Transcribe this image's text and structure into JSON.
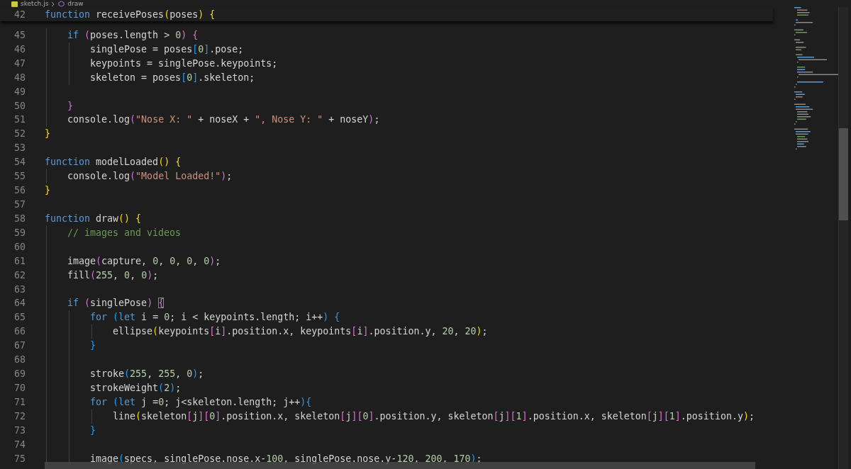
{
  "breadcrumb": {
    "file": "sketch.js",
    "symbol": "draw"
  },
  "sticky_line": {
    "number": "42",
    "tokens": [
      {
        "kind": "kw",
        "text": "function"
      },
      {
        "kind": "text",
        "text": " receivePoses"
      },
      {
        "kind": "b1",
        "text": "("
      },
      {
        "kind": "text",
        "text": "poses"
      },
      {
        "kind": "b1",
        "text": ")"
      },
      {
        "kind": "b1",
        "text": " {"
      }
    ]
  },
  "lines": [
    {
      "number": "45",
      "tokens": [
        {
          "kind": "kw",
          "text": "    if"
        },
        {
          "kind": "b2",
          "text": " ("
        },
        {
          "kind": "text",
          "text": "poses.length > "
        },
        {
          "kind": "num",
          "text": "0"
        },
        {
          "kind": "b2",
          "text": ")"
        },
        {
          "kind": "b2",
          "text": " {"
        }
      ]
    },
    {
      "number": "46",
      "tokens": [
        {
          "kind": "text",
          "text": "        singlePose = poses"
        },
        {
          "kind": "b3",
          "text": "["
        },
        {
          "kind": "num",
          "text": "0"
        },
        {
          "kind": "b3",
          "text": "]"
        },
        {
          "kind": "text",
          "text": ".pose;"
        }
      ]
    },
    {
      "number": "47",
      "tokens": [
        {
          "kind": "text",
          "text": "        keypoints = singlePose.keypoints;"
        }
      ]
    },
    {
      "number": "48",
      "tokens": [
        {
          "kind": "text",
          "text": "        skeleton = poses"
        },
        {
          "kind": "b3",
          "text": "["
        },
        {
          "kind": "num",
          "text": "0"
        },
        {
          "kind": "b3",
          "text": "]"
        },
        {
          "kind": "text",
          "text": ".skeleton;"
        }
      ]
    },
    {
      "number": "49"
    },
    {
      "number": "50",
      "tokens": [
        {
          "kind": "b2",
          "text": "    }"
        }
      ]
    },
    {
      "number": "51",
      "tokens": [
        {
          "kind": "text",
          "text": "    console.log"
        },
        {
          "kind": "b2",
          "text": "("
        },
        {
          "kind": "str",
          "text": "\"Nose X: \""
        },
        {
          "kind": "text",
          "text": " + noseX + "
        },
        {
          "kind": "str",
          "text": "\", Nose Y: \""
        },
        {
          "kind": "text",
          "text": " + noseY"
        },
        {
          "kind": "b2",
          "text": ")"
        },
        {
          "kind": "text",
          "text": ";"
        }
      ]
    },
    {
      "number": "52",
      "tokens": [
        {
          "kind": "b1",
          "text": "}"
        }
      ]
    },
    {
      "number": "53"
    },
    {
      "number": "54",
      "tokens": [
        {
          "kind": "kw",
          "text": "function"
        },
        {
          "kind": "text",
          "text": " modelLoaded"
        },
        {
          "kind": "b1",
          "text": "() {"
        }
      ]
    },
    {
      "number": "55",
      "tokens": [
        {
          "kind": "text",
          "text": "    console.log"
        },
        {
          "kind": "b2",
          "text": "("
        },
        {
          "kind": "str",
          "text": "\"Model Loaded!\""
        },
        {
          "kind": "b2",
          "text": ")"
        },
        {
          "kind": "text",
          "text": ";"
        }
      ]
    },
    {
      "number": "56",
      "tokens": [
        {
          "kind": "b1",
          "text": "}"
        }
      ]
    },
    {
      "number": "57"
    },
    {
      "number": "58",
      "tokens": [
        {
          "kind": "kw",
          "text": "function"
        },
        {
          "kind": "text",
          "text": " draw"
        },
        {
          "kind": "b1",
          "text": "() {"
        }
      ]
    },
    {
      "number": "59",
      "tokens": [
        {
          "kind": "cmt",
          "text": "    // images and videos"
        }
      ]
    },
    {
      "number": "60"
    },
    {
      "number": "61",
      "tokens": [
        {
          "kind": "text",
          "text": "    image"
        },
        {
          "kind": "b2",
          "text": "("
        },
        {
          "kind": "text",
          "text": "capture, "
        },
        {
          "kind": "num",
          "text": "0"
        },
        {
          "kind": "text",
          "text": ", "
        },
        {
          "kind": "num",
          "text": "0"
        },
        {
          "kind": "text",
          "text": ", "
        },
        {
          "kind": "num",
          "text": "0"
        },
        {
          "kind": "text",
          "text": ", "
        },
        {
          "kind": "num",
          "text": "0"
        },
        {
          "kind": "b2",
          "text": ")"
        },
        {
          "kind": "text",
          "text": ";"
        }
      ]
    },
    {
      "number": "62",
      "tokens": [
        {
          "kind": "text",
          "text": "    fill"
        },
        {
          "kind": "b2",
          "text": "("
        },
        {
          "kind": "num",
          "text": "255"
        },
        {
          "kind": "text",
          "text": ", "
        },
        {
          "kind": "num",
          "text": "0"
        },
        {
          "kind": "text",
          "text": ", "
        },
        {
          "kind": "num",
          "text": "0"
        },
        {
          "kind": "b2",
          "text": ")"
        },
        {
          "kind": "text",
          "text": ";"
        }
      ]
    },
    {
      "number": "63"
    },
    {
      "number": "64",
      "tokens": [
        {
          "kind": "kw",
          "text": "    if"
        },
        {
          "kind": "b2",
          "text": " ("
        },
        {
          "kind": "text",
          "text": "singlePose"
        },
        {
          "kind": "b2",
          "text": ") "
        },
        {
          "kind": "b2-match",
          "text": "{"
        }
      ]
    },
    {
      "number": "65",
      "tokens": [
        {
          "kind": "kw",
          "text": "        for"
        },
        {
          "kind": "b3",
          "text": " ("
        },
        {
          "kind": "kw",
          "text": "let"
        },
        {
          "kind": "text",
          "text": " i = "
        },
        {
          "kind": "num",
          "text": "0"
        },
        {
          "kind": "text",
          "text": "; i < keypoints.length; i++"
        },
        {
          "kind": "b3",
          "text": ") {"
        }
      ]
    },
    {
      "number": "66",
      "tokens": [
        {
          "kind": "text",
          "text": "            ellipse"
        },
        {
          "kind": "b1",
          "text": "("
        },
        {
          "kind": "text",
          "text": "keypoints"
        },
        {
          "kind": "b2",
          "text": "["
        },
        {
          "kind": "text",
          "text": "i"
        },
        {
          "kind": "b2",
          "text": "]"
        },
        {
          "kind": "text",
          "text": ".position.x, keypoints"
        },
        {
          "kind": "b2",
          "text": "["
        },
        {
          "kind": "text",
          "text": "i"
        },
        {
          "kind": "b2",
          "text": "]"
        },
        {
          "kind": "text",
          "text": ".position.y, "
        },
        {
          "kind": "num",
          "text": "20"
        },
        {
          "kind": "text",
          "text": ", "
        },
        {
          "kind": "num",
          "text": "20"
        },
        {
          "kind": "b1",
          "text": ")"
        },
        {
          "kind": "text",
          "text": ";"
        }
      ]
    },
    {
      "number": "67",
      "tokens": [
        {
          "kind": "b3",
          "text": "        }"
        }
      ]
    },
    {
      "number": "68"
    },
    {
      "number": "69",
      "tokens": [
        {
          "kind": "text",
          "text": "        stroke"
        },
        {
          "kind": "b3",
          "text": "("
        },
        {
          "kind": "num",
          "text": "255"
        },
        {
          "kind": "text",
          "text": ", "
        },
        {
          "kind": "num",
          "text": "255"
        },
        {
          "kind": "text",
          "text": ", "
        },
        {
          "kind": "num",
          "text": "0"
        },
        {
          "kind": "b3",
          "text": ")"
        },
        {
          "kind": "text",
          "text": ";"
        }
      ]
    },
    {
      "number": "70",
      "tokens": [
        {
          "kind": "text",
          "text": "        strokeWeight"
        },
        {
          "kind": "b3",
          "text": "("
        },
        {
          "kind": "num",
          "text": "2"
        },
        {
          "kind": "b3",
          "text": ")"
        },
        {
          "kind": "text",
          "text": ";"
        }
      ]
    },
    {
      "number": "71",
      "tokens": [
        {
          "kind": "kw",
          "text": "        for"
        },
        {
          "kind": "b3",
          "text": " ("
        },
        {
          "kind": "kw",
          "text": "let"
        },
        {
          "kind": "text",
          "text": " j ="
        },
        {
          "kind": "num",
          "text": "0"
        },
        {
          "kind": "text",
          "text": "; j<skeleton.length; j++"
        },
        {
          "kind": "b3",
          "text": "){"
        }
      ]
    },
    {
      "number": "72",
      "tokens": [
        {
          "kind": "text",
          "text": "            line"
        },
        {
          "kind": "b1",
          "text": "("
        },
        {
          "kind": "text",
          "text": "skeleton"
        },
        {
          "kind": "b2",
          "text": "["
        },
        {
          "kind": "text",
          "text": "j"
        },
        {
          "kind": "b2",
          "text": "]["
        },
        {
          "kind": "num",
          "text": "0"
        },
        {
          "kind": "b2",
          "text": "]"
        },
        {
          "kind": "text",
          "text": ".position.x, skeleton"
        },
        {
          "kind": "b2",
          "text": "["
        },
        {
          "kind": "text",
          "text": "j"
        },
        {
          "kind": "b2",
          "text": "]["
        },
        {
          "kind": "num",
          "text": "0"
        },
        {
          "kind": "b2",
          "text": "]"
        },
        {
          "kind": "text",
          "text": ".position.y, skeleton"
        },
        {
          "kind": "b2",
          "text": "["
        },
        {
          "kind": "text",
          "text": "j"
        },
        {
          "kind": "b2",
          "text": "]["
        },
        {
          "kind": "num",
          "text": "1"
        },
        {
          "kind": "b2",
          "text": "]"
        },
        {
          "kind": "text",
          "text": ".position.x, skeleton"
        },
        {
          "kind": "b2",
          "text": "["
        },
        {
          "kind": "text",
          "text": "j"
        },
        {
          "kind": "b2",
          "text": "]["
        },
        {
          "kind": "num",
          "text": "1"
        },
        {
          "kind": "b2",
          "text": "]"
        },
        {
          "kind": "text",
          "text": ".position.y"
        },
        {
          "kind": "b1",
          "text": ")"
        },
        {
          "kind": "text",
          "text": ";"
        }
      ]
    },
    {
      "number": "73",
      "tokens": [
        {
          "kind": "b3",
          "text": "        }"
        }
      ]
    },
    {
      "number": "74"
    },
    {
      "number": "75",
      "tokens": [
        {
          "kind": "text",
          "text": "        image"
        },
        {
          "kind": "b3",
          "text": "("
        },
        {
          "kind": "text",
          "text": "specs, singlePose.nose.x-"
        },
        {
          "kind": "num",
          "text": "100"
        },
        {
          "kind": "text",
          "text": ", singlePose.nose.y-"
        },
        {
          "kind": "num",
          "text": "120"
        },
        {
          "kind": "text",
          "text": ", "
        },
        {
          "kind": "num",
          "text": "200"
        },
        {
          "kind": "text",
          "text": ", "
        },
        {
          "kind": "num",
          "text": "170"
        },
        {
          "kind": "b3",
          "text": ")"
        },
        {
          "kind": "text",
          "text": ";"
        }
      ]
    }
  ]
}
